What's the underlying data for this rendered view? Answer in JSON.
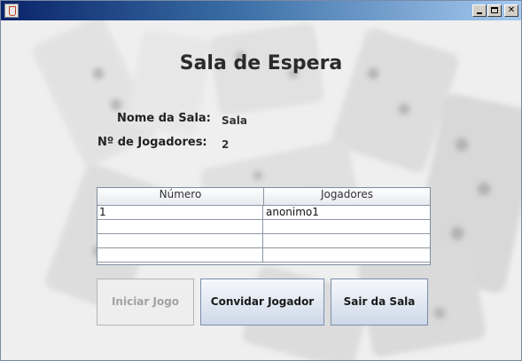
{
  "window": {
    "title": ""
  },
  "page": {
    "title": "Sala de Espera",
    "room_name_label": "Nome da Sala:",
    "room_name_value": "Sala",
    "players_count_label": "Nº de Jogadores:",
    "players_count_value": "2"
  },
  "table": {
    "columns": [
      "Número",
      "Jogadores"
    ],
    "rows": [
      [
        "1",
        "anonimo1"
      ],
      [
        "",
        ""
      ],
      [
        "",
        ""
      ],
      [
        "",
        ""
      ]
    ]
  },
  "buttons": {
    "start": {
      "label": "Iniciar Jogo",
      "enabled": false
    },
    "invite": {
      "label": "Convidar Jogador",
      "enabled": true
    },
    "leave": {
      "label": "Sair da Sala",
      "enabled": true
    }
  },
  "colors": {
    "title_bar_start": "#0a246a",
    "title_bar_end": "#a6caf0",
    "button_border": "#7d8fae"
  },
  "background_image": "domino-tiles"
}
